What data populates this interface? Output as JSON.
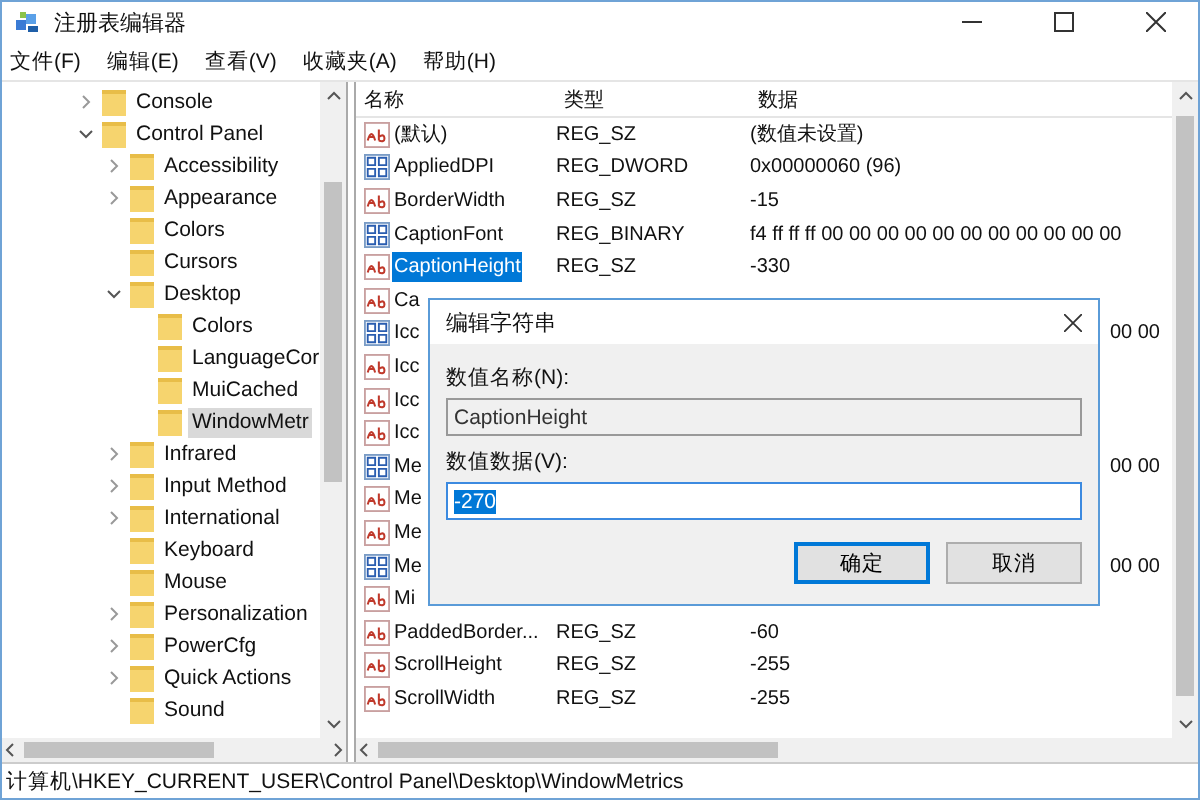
{
  "window": {
    "title": "注册表编辑器"
  },
  "menu": [
    "文件(F)",
    "编辑(E)",
    "查看(V)",
    "收藏夹(A)",
    "帮助(H)"
  ],
  "tree": [
    {
      "label": "Console",
      "expanded": false,
      "selected": false
    },
    {
      "label": "Control Panel",
      "expanded": true,
      "selected": false,
      "children": [
        {
          "label": "Accessibility",
          "expanded": false,
          "selected": false
        },
        {
          "label": "Appearance",
          "expanded": false,
          "selected": false
        },
        {
          "label": "Colors",
          "selected": false
        },
        {
          "label": "Cursors",
          "selected": false
        },
        {
          "label": "Desktop",
          "expanded": true,
          "selected": false,
          "children": [
            {
              "label": "Colors",
              "selected": false
            },
            {
              "label": "LanguageCor",
              "selected": false
            },
            {
              "label": "MuiCached",
              "selected": false
            },
            {
              "label": "WindowMetr",
              "selected": true
            }
          ]
        },
        {
          "label": "Infrared",
          "expanded": false,
          "selected": false
        },
        {
          "label": "Input Method",
          "expanded": false,
          "selected": false
        },
        {
          "label": "International",
          "expanded": false,
          "selected": false
        },
        {
          "label": "Keyboard",
          "selected": false
        },
        {
          "label": "Mouse",
          "selected": false
        },
        {
          "label": "Personalization",
          "expanded": false,
          "selected": false
        },
        {
          "label": "PowerCfg",
          "expanded": false,
          "selected": false
        },
        {
          "label": "Quick Actions",
          "expanded": false,
          "selected": false
        },
        {
          "label": "Sound",
          "selected": false
        }
      ]
    }
  ],
  "table": {
    "columns": [
      "名称",
      "类型",
      "数据"
    ],
    "rows": [
      {
        "kind": "string",
        "name": "(默认)",
        "type": "REG_SZ",
        "data": "(数值未设置)",
        "selected": false
      },
      {
        "kind": "binary",
        "name": "AppliedDPI",
        "type": "REG_DWORD",
        "data": "0x00000060 (96)",
        "selected": false
      },
      {
        "kind": "string",
        "name": "BorderWidth",
        "type": "REG_SZ",
        "data": "-15",
        "selected": false
      },
      {
        "kind": "binary",
        "name": "CaptionFont",
        "type": "REG_BINARY",
        "data": "f4 ff ff ff 00 00 00 00 00 00 00 00 00 00 00",
        "selected": false
      },
      {
        "kind": "string",
        "name": "CaptionHeight",
        "type": "REG_SZ",
        "data": "-330",
        "selected": true
      },
      {
        "kind": "string",
        "name": "Ca",
        "selected": false
      },
      {
        "kind": "binary",
        "name": "Icc",
        "data": "00 00",
        "selected": false
      },
      {
        "kind": "string",
        "name": "Icc",
        "selected": false
      },
      {
        "kind": "string",
        "name": "Icc",
        "selected": false
      },
      {
        "kind": "string",
        "name": "Icc",
        "selected": false
      },
      {
        "kind": "binary",
        "name": "Me",
        "data": "00 00",
        "selected": false
      },
      {
        "kind": "string",
        "name": "Me",
        "selected": false
      },
      {
        "kind": "string",
        "name": "Me",
        "selected": false
      },
      {
        "kind": "binary",
        "name": "Me",
        "data": "00 00",
        "selected": false
      },
      {
        "kind": "string",
        "name": "Mi",
        "selected": false
      },
      {
        "kind": "string",
        "name": "PaddedBorder...",
        "type": "REG_SZ",
        "data": "-60",
        "selected": false
      },
      {
        "kind": "string",
        "name": "ScrollHeight",
        "type": "REG_SZ",
        "data": "-255",
        "selected": false
      },
      {
        "kind": "string",
        "name": "ScrollWidth",
        "type": "REG_SZ",
        "data": "-255",
        "selected": false
      }
    ]
  },
  "dialog": {
    "title": "编辑字符串",
    "name_label": "数值名称(N):",
    "name_value": "CaptionHeight",
    "data_label": "数值数据(V):",
    "data_value": "-270",
    "buttons": [
      "确定",
      "取消"
    ]
  },
  "status_bar": "计算机\\HKEY_CURRENT_USER\\Control Panel\\Desktop\\WindowMetrics"
}
